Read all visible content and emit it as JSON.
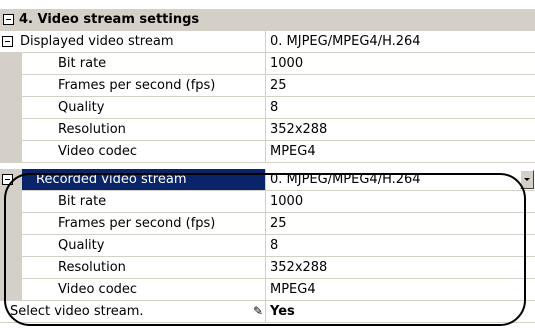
{
  "category": {
    "label": "4. Video stream settings"
  },
  "displayed": {
    "label": "Displayed video stream",
    "value": "0. MJPEG/MPEG4/H.264",
    "props": [
      {
        "label": "Bit rate",
        "value": "1000"
      },
      {
        "label": "Frames per second (fps)",
        "value": "25"
      },
      {
        "label": "Quality",
        "value": "8"
      },
      {
        "label": "Resolution",
        "value": "352x288"
      },
      {
        "label": "Video codec",
        "value": "MPEG4"
      }
    ]
  },
  "recorded": {
    "label": "Recorded video stream",
    "value": "0. MJPEG/MPEG4/H.264",
    "props": [
      {
        "label": "Bit rate",
        "value": "1000"
      },
      {
        "label": "Frames per second (fps)",
        "value": "25"
      },
      {
        "label": "Quality",
        "value": "8"
      },
      {
        "label": "Resolution",
        "value": "352x288"
      },
      {
        "label": "Video codec",
        "value": "MPEG4"
      }
    ]
  },
  "select_stream": {
    "label": "Select video stream.",
    "value": "Yes"
  }
}
